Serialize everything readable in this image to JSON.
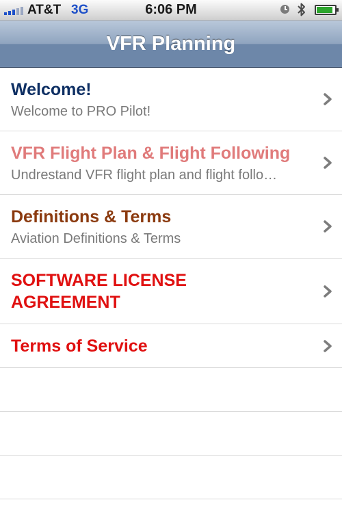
{
  "status_bar": {
    "carrier": "AT&T",
    "network": "3G",
    "time": "6:06 PM",
    "icons": [
      "signal-icon",
      "clock-icon",
      "bluetooth-icon",
      "battery-icon"
    ]
  },
  "nav_bar": {
    "title": "VFR Planning"
  },
  "colors": {
    "welcome_title": "#0e2f63",
    "vfr_title": "#e07b7b",
    "definitions_title": "#8b3a0f",
    "license_title": "#e01010",
    "terms_title": "#e01010",
    "subtitle": "#7a7a7a",
    "nav_bar": "#6d87a9"
  },
  "table": {
    "rows": [
      {
        "title": "Welcome!",
        "subtitle": "Welcome to PRO Pilot!"
      },
      {
        "title": "VFR Flight Plan & Flight Following",
        "subtitle": "Undrestand VFR flight plan and flight follo…"
      },
      {
        "title": "Definitions & Terms",
        "subtitle": "Aviation Definitions & Terms"
      },
      {
        "title": "SOFTWARE LICENSE AGREEMENT",
        "subtitle": ""
      },
      {
        "title": "Terms of Service",
        "subtitle": ""
      }
    ]
  }
}
